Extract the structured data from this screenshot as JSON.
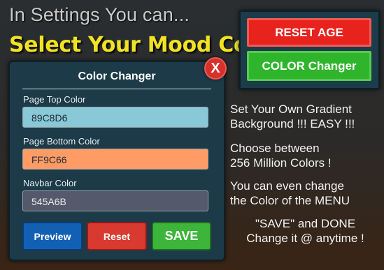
{
  "headline": {
    "line1": "In Settings You can...",
    "line2": "Select Your Mood Color"
  },
  "panel": {
    "title": "Color Changer",
    "close_label": "X",
    "fields": [
      {
        "label": "Page Top Color",
        "value": "89C8D6",
        "bg": "#89C8D6"
      },
      {
        "label": "Page Bottom Color",
        "value": "FF9C66",
        "bg": "#FF9C66"
      },
      {
        "label": "Navbar Color",
        "value": "545A6B",
        "bg": "#545A6B",
        "text_color": "#e8e8ec"
      }
    ],
    "buttons": {
      "preview": "Preview",
      "reset": "Reset",
      "save": "SAVE"
    }
  },
  "side": {
    "reset_age": "RESET AGE",
    "color_changer": "COLOR Changer"
  },
  "info": {
    "p1_l1": "Set Your Own Gradient",
    "p1_l2": "Background !!! EASY !!!",
    "p2_l1": "Choose between",
    "p2_l2": "256 Million Colors !",
    "p3_l1": "You can even change",
    "p3_l2": "the Color of the MENU",
    "p4_l1": "\"SAVE\" and DONE",
    "p4_l2": "Change it @ anytime !"
  },
  "colors": {
    "preview_btn": "#1260b3",
    "reset_btn": "#d93a2f",
    "save_btn": "#3cb53a",
    "reset_age_btn": "#e8231e",
    "color_changer_btn": "#2fb52b",
    "headline_yellow": "#f1e324"
  }
}
